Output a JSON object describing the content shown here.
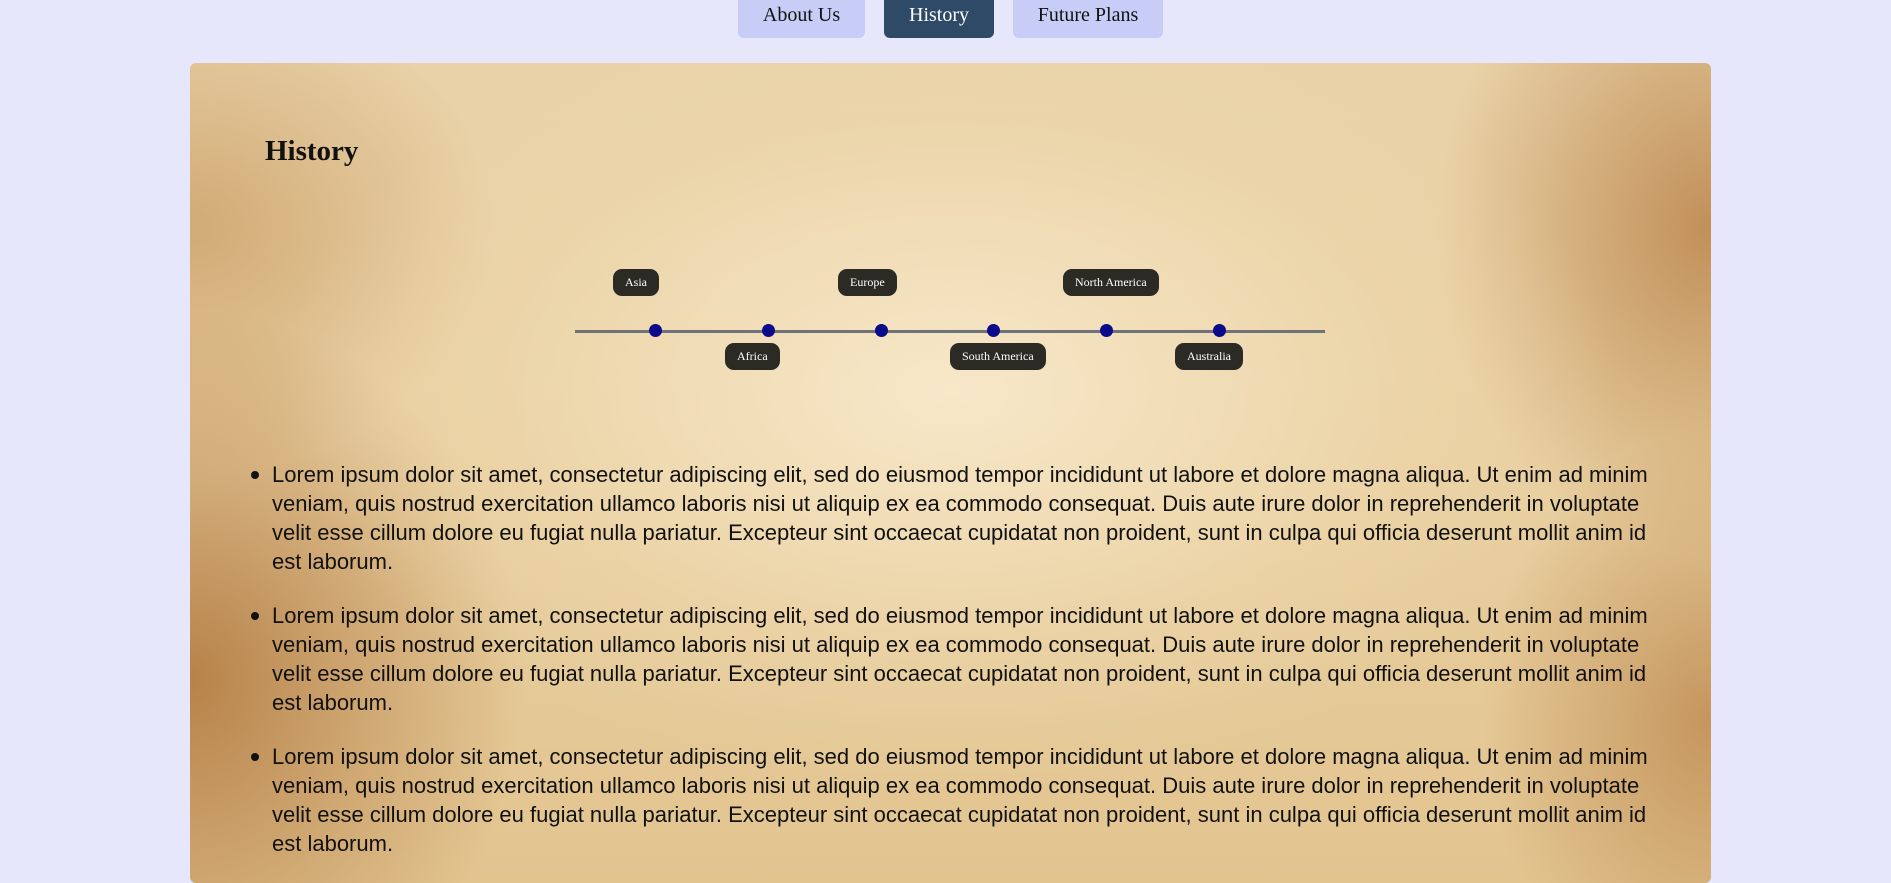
{
  "nav": {
    "tabs": [
      {
        "label": "About Us"
      },
      {
        "label": "History"
      },
      {
        "label": "Future Plans"
      }
    ]
  },
  "panel": {
    "title": "History",
    "timeline": {
      "labels": [
        "Asia",
        "Africa",
        "Europe",
        "South America",
        "North America",
        "Australia"
      ]
    },
    "items": [
      "Lorem ipsum dolor sit amet, consectetur adipiscing elit, sed do eiusmod tempor incididunt ut labore et dolore magna aliqua. Ut enim ad minim veniam, quis nostrud exercitation ullamco laboris nisi ut aliquip ex ea commodo consequat. Duis aute irure dolor in reprehenderit in voluptate velit esse cillum dolore eu fugiat nulla pariatur. Excepteur sint occaecat cupidatat non proident, sunt in culpa qui officia deserunt mollit anim id est laborum.",
      "Lorem ipsum dolor sit amet, consectetur adipiscing elit, sed do eiusmod tempor incididunt ut labore et dolore magna aliqua. Ut enim ad minim veniam, quis nostrud exercitation ullamco laboris nisi ut aliquip ex ea commodo consequat. Duis aute irure dolor in reprehenderit in voluptate velit esse cillum dolore eu fugiat nulla pariatur. Excepteur sint occaecat cupidatat non proident, sunt in culpa qui officia deserunt mollit anim id est laborum.",
      "Lorem ipsum dolor sit amet, consectetur adipiscing elit, sed do eiusmod tempor incididunt ut labore et dolore magna aliqua. Ut enim ad minim veniam, quis nostrud exercitation ullamco laboris nisi ut aliquip ex ea commodo consequat. Duis aute irure dolor in reprehenderit in voluptate velit esse cillum dolore eu fugiat nulla pariatur. Excepteur sint occaecat cupidatat non proident, sunt in culpa qui officia deserunt mollit anim id est laborum."
    ]
  },
  "colors": {
    "page_background": "#e6e7fa",
    "tab_background": "#c8cdf7",
    "tab_active_background": "#2e4a66",
    "timeline_dot": "#0a0a8a",
    "timeline_label_background": "#2c2a24"
  }
}
